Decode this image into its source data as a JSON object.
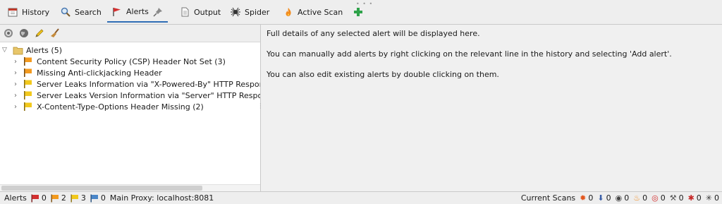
{
  "tabs": [
    {
      "label": "History",
      "icon": "calendar-icon"
    },
    {
      "label": "Search",
      "icon": "search-icon"
    },
    {
      "label": "Alerts",
      "icon": "flag-icon",
      "active": true
    },
    {
      "label": "Output",
      "icon": "document-icon"
    },
    {
      "label": "Spider",
      "icon": "spider-icon"
    },
    {
      "label": "Active Scan",
      "icon": "fire-icon"
    }
  ],
  "toolbar": {
    "icons": [
      "target-icon",
      "globe-icon",
      "pencil-icon",
      "broom-icon"
    ]
  },
  "tree": {
    "root": "Alerts (5)",
    "items": [
      {
        "label": "Content Security Policy (CSP) Header Not Set (3)",
        "risk": "medium"
      },
      {
        "label": "Missing Anti-clickjacking Header",
        "risk": "medium"
      },
      {
        "label": "Server Leaks Information via \"X-Powered-By\" HTTP Response",
        "risk": "low"
      },
      {
        "label": "Server Leaks Version Information via \"Server\" HTTP Response",
        "risk": "low"
      },
      {
        "label": "X-Content-Type-Options Header Missing (2)",
        "risk": "low"
      }
    ]
  },
  "details": {
    "line1": "Full details of any selected alert will be displayed here.",
    "line2": "You can manually add alerts by right clicking on the relevant line in the history and selecting 'Add alert'.",
    "line3": "You can also edit existing alerts by double clicking on them."
  },
  "status": {
    "alerts_label": "Alerts",
    "high": "0",
    "medium": "2",
    "low": "3",
    "info": "0",
    "proxy": "Main Proxy: localhost:8081",
    "scans_label": "Current Scans",
    "scans": [
      "0",
      "0",
      "0",
      "0",
      "0",
      "0",
      "0",
      "0"
    ]
  },
  "colors": {
    "high": "#d32f2f",
    "medium": "#f39a1e",
    "low": "#f2c81b",
    "info": "#4a86c8",
    "accent": "#2f6db5",
    "folder": "#e8c66a"
  }
}
